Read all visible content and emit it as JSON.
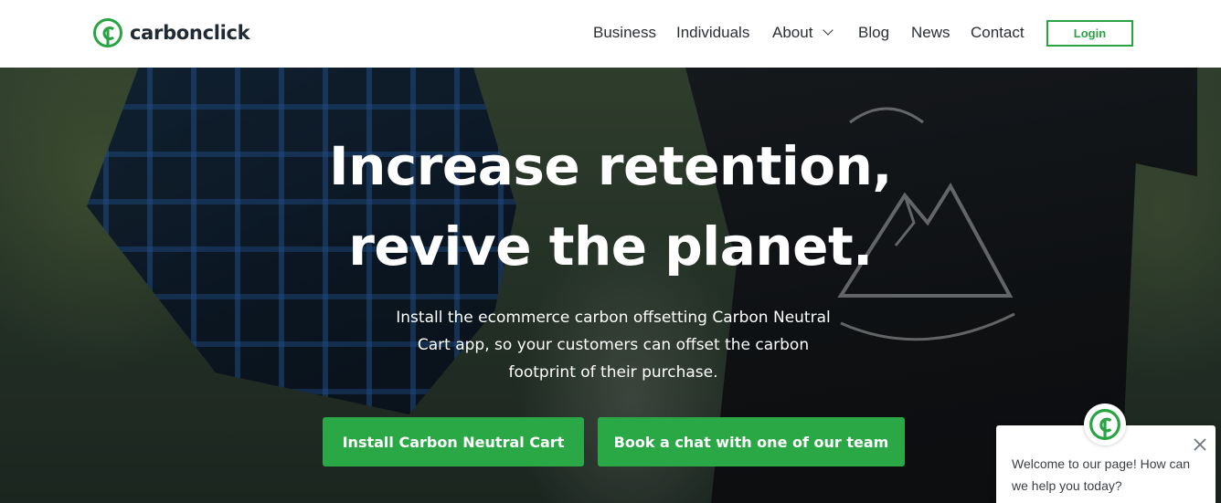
{
  "brand": {
    "name": "carbonclick",
    "accent": "#29a443"
  },
  "nav": {
    "items": [
      {
        "label": "Business"
      },
      {
        "label": "Individuals"
      },
      {
        "label": "About"
      },
      {
        "label": "Blog"
      },
      {
        "label": "News"
      },
      {
        "label": "Contact"
      }
    ],
    "login_label": "Login"
  },
  "hero": {
    "headline_line1": "Increase retention,",
    "headline_line2": "revive the planet.",
    "subtext_line1": "Install the ecommerce carbon offsetting Carbon Neutral",
    "subtext_line2": "Cart app, so your customers can offset the carbon",
    "subtext_line3": "footprint of their purchase.",
    "primary_cta": "Install Carbon Neutral Cart",
    "secondary_cta": "Book a chat with one of our team",
    "button_color": "#2aa845"
  },
  "chat": {
    "message": "Welcome to our page! How can we help you today?",
    "avatar_icon": "carbonclick-logo-icon",
    "close_icon": "close-icon"
  },
  "icons": {
    "nav_about_dropdown": "chevron-down-icon",
    "logo": "carbonclick-logo-icon"
  }
}
